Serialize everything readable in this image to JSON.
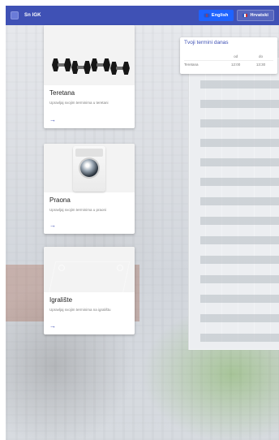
{
  "header": {
    "title": "Sn IGK",
    "menu_icon": "menu-icon",
    "languages": [
      {
        "label": "English",
        "active": true,
        "flag_icon": "uk-flag-icon"
      },
      {
        "label": "Hrvatski",
        "active": false,
        "flag_icon": "croatia-flag-icon"
      }
    ]
  },
  "facilities": [
    {
      "name": "Teretana",
      "description": "Upravljaj svojim terminima u teretani"
    },
    {
      "name": "Praona",
      "description": "Upravljaj svojim terminima u praoni"
    },
    {
      "name": "Igralište",
      "description": "Upravljaj svojim terminima na igralištu"
    }
  ],
  "schedule": {
    "title": "Tvoji termini danas",
    "columns": [
      "",
      "od",
      "do"
    ],
    "rows": [
      {
        "facility": "Teretana",
        "from": "12:00",
        "to": "13:30"
      }
    ]
  },
  "ui": {
    "action_arrow": "→"
  },
  "colors": {
    "primary": "#3f51b5",
    "accent": "#1e63ff"
  }
}
